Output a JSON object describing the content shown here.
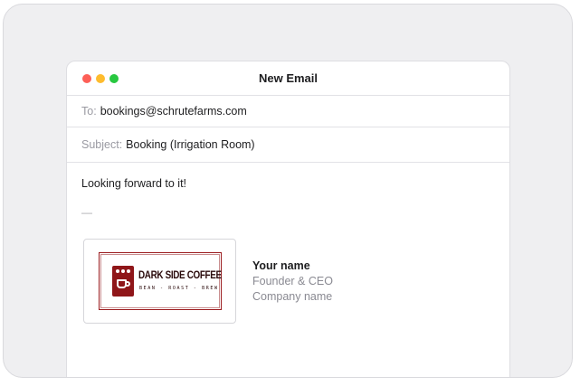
{
  "window": {
    "title": "New Email"
  },
  "to": {
    "label": "To:",
    "value": "bookings@schrutefarms.com"
  },
  "subject": {
    "label": "Subject:",
    "value": "Booking (Irrigation Room)"
  },
  "body": {
    "text": "Looking forward to it!",
    "separator": "—"
  },
  "signature": {
    "logo": {
      "name": "DARK SIDE COFFEE",
      "tagline": "BEAN - ROAST - BREW",
      "brand_color": "#8f1619"
    },
    "name": "Your name",
    "role": "Founder & CEO",
    "company": "Company name"
  }
}
